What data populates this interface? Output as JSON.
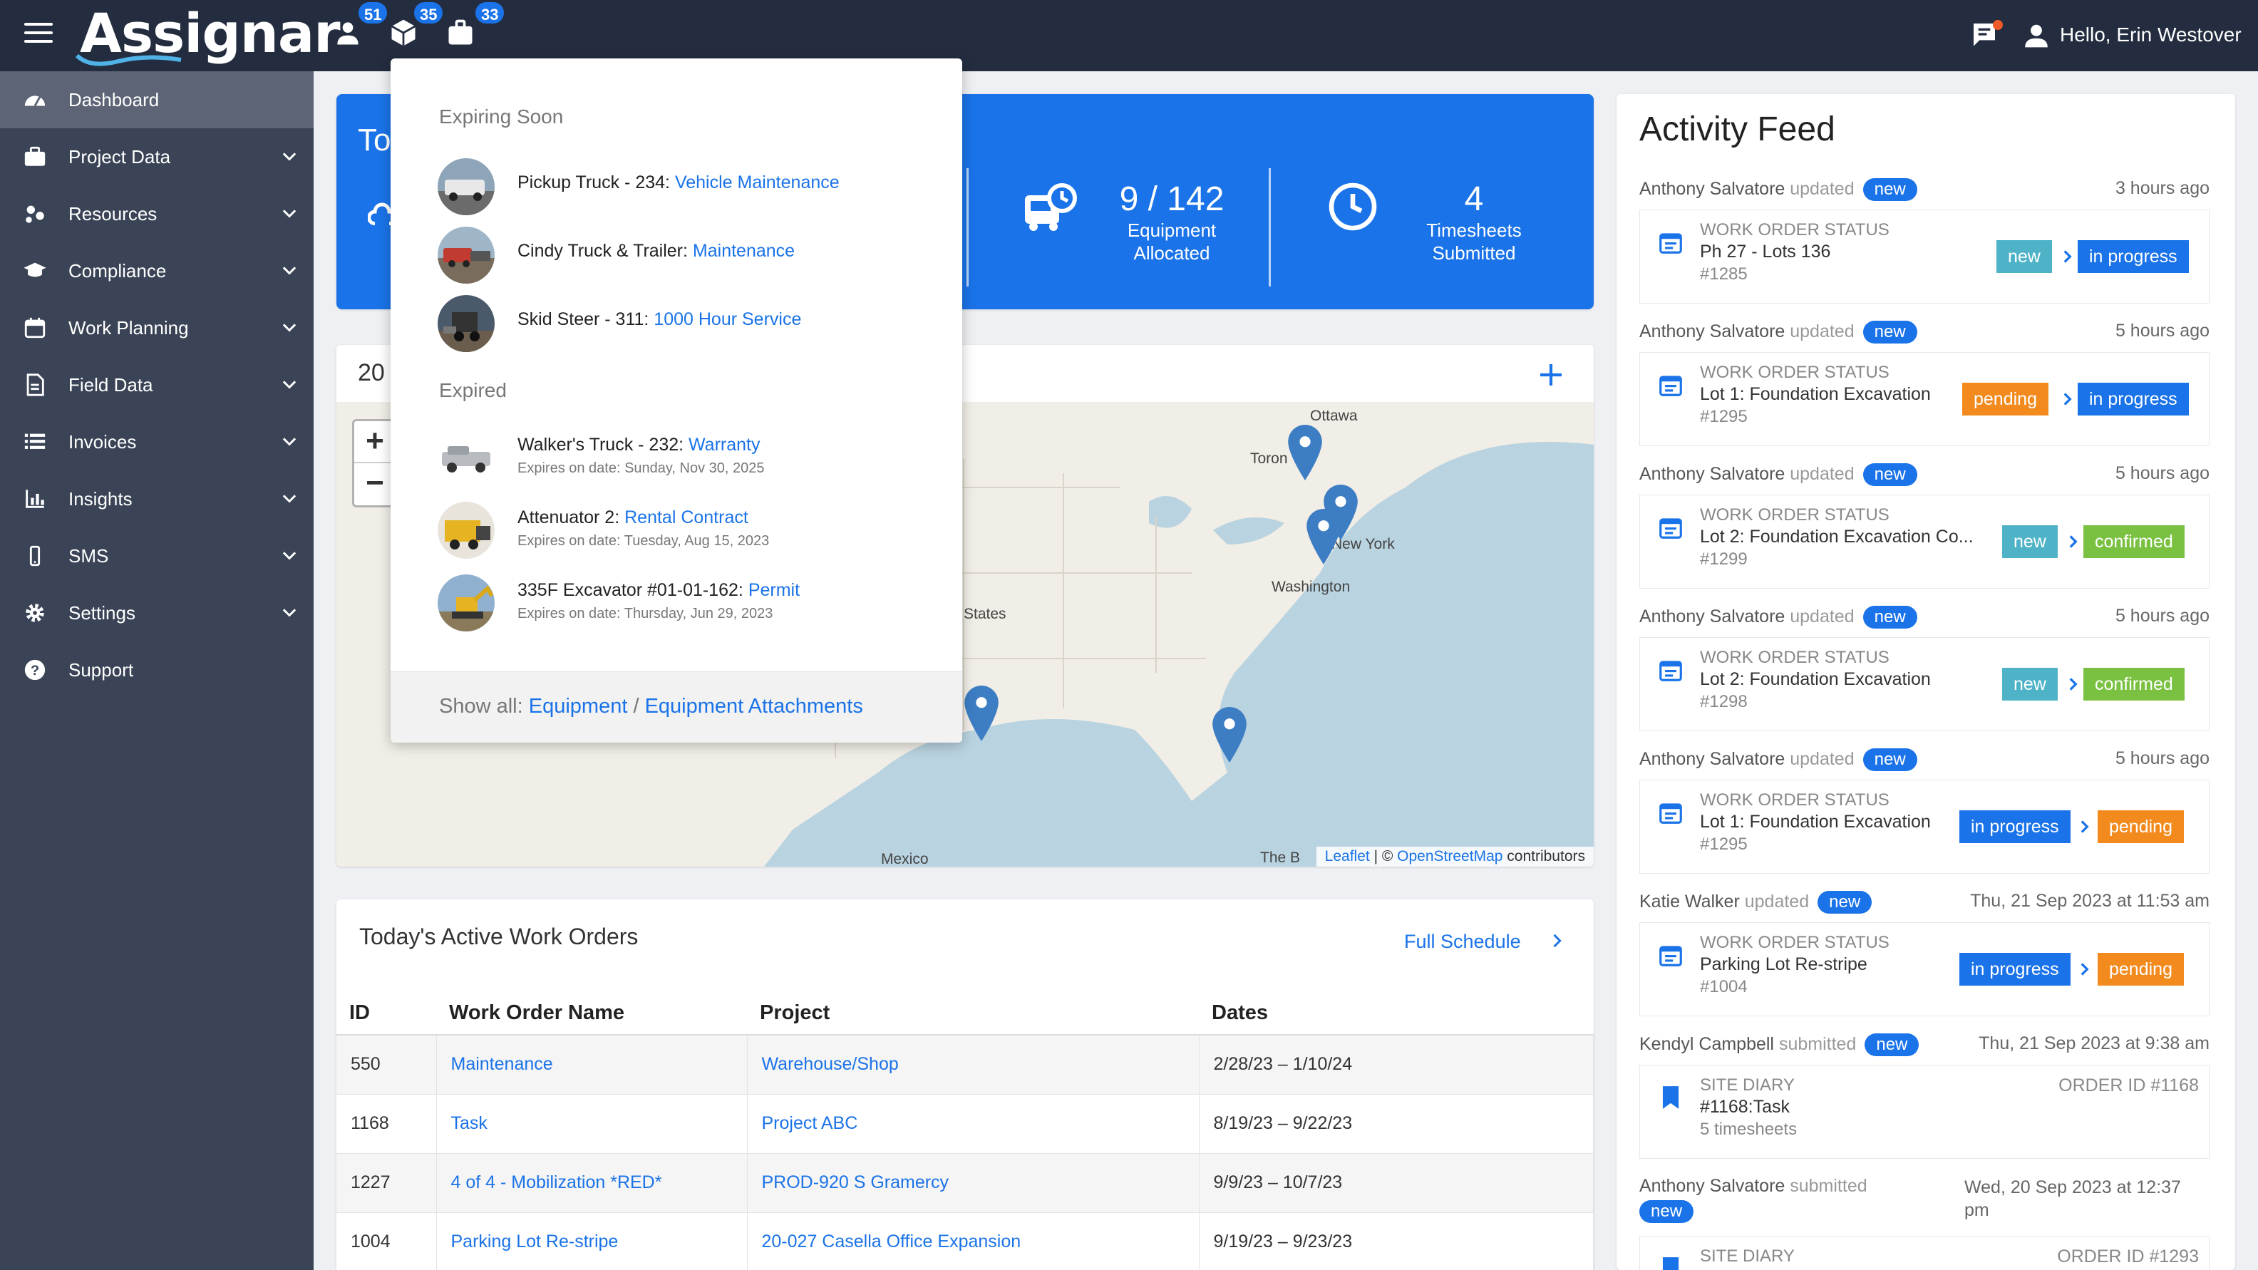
{
  "app": {
    "logo": "Assignar",
    "greeting": "Hello, Erin Westover",
    "badges": {
      "people": "51",
      "equipment": "35",
      "jobs": "33"
    },
    "accent": "#1a73e8"
  },
  "sidebar": {
    "items": [
      {
        "label": "Dashboard",
        "icon": "dashboard-icon"
      },
      {
        "label": "Project Data",
        "icon": "briefcase-icon"
      },
      {
        "label": "Resources",
        "icon": "resources-icon"
      },
      {
        "label": "Compliance",
        "icon": "graduation-cap-icon"
      },
      {
        "label": "Work Planning",
        "icon": "calendar-icon"
      },
      {
        "label": "Field Data",
        "icon": "document-icon"
      },
      {
        "label": "Invoices",
        "icon": "list-icon"
      },
      {
        "label": "Insights",
        "icon": "bar-chart-icon"
      },
      {
        "label": "SMS",
        "icon": "phone-icon"
      },
      {
        "label": "Settings",
        "icon": "gear-icon"
      },
      {
        "label": "Support",
        "icon": "help-icon"
      }
    ]
  },
  "stats": {
    "title_fragment": "To",
    "equipment": {
      "value": "9 / 142",
      "label_line1": "Equipment",
      "label_line2": "Allocated"
    },
    "timesheets": {
      "value": "4",
      "label_line1": "Timesheets",
      "label_line2": "Submitted"
    }
  },
  "map": {
    "heading_fragment": "20",
    "cities": {
      "ottawa": "Ottawa",
      "toronto": "Toron",
      "newyork": "New York",
      "washington": "Washington",
      "states": "States",
      "mexico": "Mexico",
      "bahamas": "The B"
    },
    "attribution": {
      "leaflet": "Leaflet",
      "sep": " | © ",
      "osm": "OpenStreetMap",
      "contrib": " contributors"
    }
  },
  "work_orders": {
    "title": "Today's Active Work Orders",
    "full_schedule": "Full Schedule",
    "columns": [
      "ID",
      "Work Order Name",
      "Project",
      "Dates"
    ],
    "rows": [
      {
        "id": "550",
        "name": "Maintenance",
        "project": "Warehouse/Shop",
        "dates": "2/28/23 – 1/10/24"
      },
      {
        "id": "1168",
        "name": "Task",
        "project": "Project ABC",
        "dates": "8/19/23 – 9/22/23"
      },
      {
        "id": "1227",
        "name": "4 of 4 - Mobilization *RED*",
        "project": "PROD-920 S Gramercy",
        "dates": "9/9/23 – 10/7/23"
      },
      {
        "id": "1004",
        "name": "Parking Lot Re-stripe",
        "project": "20-027 Casella Office Expansion",
        "dates": "9/19/23 – 9/23/23"
      }
    ]
  },
  "feed": {
    "title": "Activity Feed",
    "entries": [
      {
        "user": "Anthony Salvatore",
        "verb": "updated",
        "pill": "new",
        "time": "3 hours ago",
        "type": "WORK ORDER STATUS",
        "name": "Ph 27 - Lots 136",
        "num": "#1285",
        "from": "new",
        "to": "in progress"
      },
      {
        "user": "Anthony Salvatore",
        "verb": "updated",
        "pill": "new",
        "time": "5 hours ago",
        "type": "WORK ORDER STATUS",
        "name": "Lot 1: Foundation Excavation",
        "num": "#1295",
        "from": "pending",
        "to": "in progress"
      },
      {
        "user": "Anthony Salvatore",
        "verb": "updated",
        "pill": "new",
        "time": "5 hours ago",
        "type": "WORK ORDER STATUS",
        "name": "Lot 2: Foundation Excavation Co...",
        "num": "#1299",
        "from": "new",
        "to": "confirmed"
      },
      {
        "user": "Anthony Salvatore",
        "verb": "updated",
        "pill": "new",
        "time": "5 hours ago",
        "type": "WORK ORDER STATUS",
        "name": "Lot 2: Foundation Excavation",
        "num": "#1298",
        "from": "new",
        "to": "confirmed"
      },
      {
        "user": "Anthony Salvatore",
        "verb": "updated",
        "pill": "new",
        "time": "5 hours ago",
        "type": "WORK ORDER STATUS",
        "name": "Lot 1: Foundation Excavation",
        "num": "#1295",
        "from": "in progress",
        "to": "pending"
      },
      {
        "user": "Katie Walker",
        "verb": "updated",
        "pill": "new",
        "time": "Thu, 21 Sep 2023 at 11:53 am",
        "type": "WORK ORDER STATUS",
        "name": "Parking Lot Re-stripe",
        "num": "#1004",
        "from": "in progress",
        "to": "pending"
      },
      {
        "user": "Kendyl Campbell",
        "verb": "submitted",
        "pill": "new",
        "time": "Thu, 21 Sep 2023 at 9:38 am",
        "type": "SITE DIARY",
        "name": "#1168:Task",
        "num": "5 timesheets",
        "order": "ORDER ID #1168"
      },
      {
        "user": "Anthony Salvatore",
        "verb": "submitted",
        "pill": "new",
        "time_line1": "Wed, 20 Sep 2023 at 12:37",
        "time_line2": "pm",
        "type": "SITE DIARY",
        "order": "ORDER ID #1293"
      }
    ]
  },
  "dropdown": {
    "expiring_title": "Expiring Soon",
    "expired_title": "Expired",
    "expiring": [
      {
        "name": "Pickup Truck - 234: ",
        "link": "Vehicle Maintenance"
      },
      {
        "name": "Cindy Truck & Trailer: ",
        "link": "Maintenance"
      },
      {
        "name": "Skid Steer - 311: ",
        "link": "1000 Hour Service"
      }
    ],
    "expired": [
      {
        "name": "Walker's Truck - 232: ",
        "link": "Warranty",
        "sub": "Expires on date: Sunday, Nov 30, 2025"
      },
      {
        "name": "Attenuator 2: ",
        "link": "Rental Contract",
        "sub": "Expires on date: Tuesday, Aug 15, 2023"
      },
      {
        "name": "335F Excavator #01-01-162: ",
        "link": "Permit",
        "sub": "Expires on date: Thursday, Jun 29, 2023"
      }
    ],
    "footer_prefix": "Show all: ",
    "footer_link1": "Equipment",
    "footer_sep": " / ",
    "footer_link2": "Equipment Attachments"
  }
}
